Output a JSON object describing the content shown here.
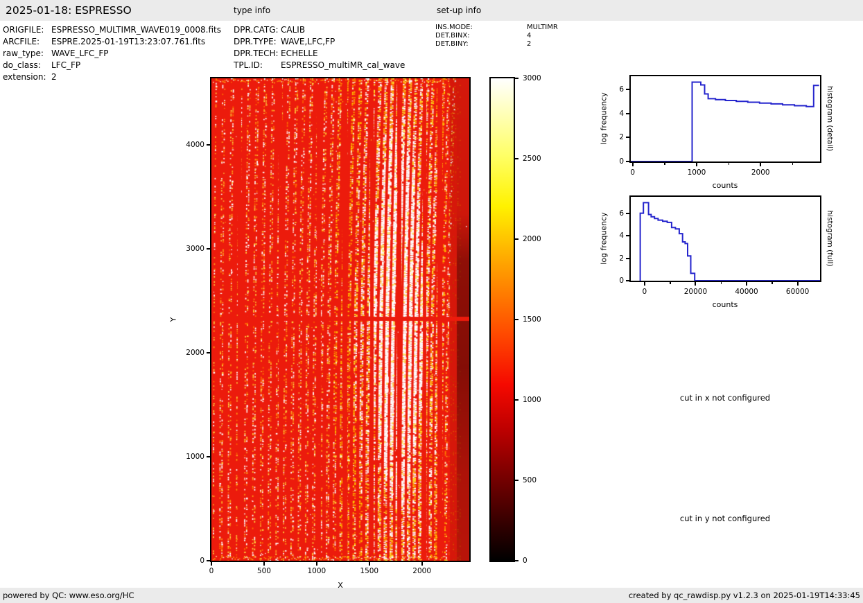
{
  "header": {
    "title": "2025-01-18: ESPRESSO",
    "type_info": "type info",
    "setup_info": "set-up info"
  },
  "file_info": {
    "rows": [
      {
        "label": "ORIGFILE:",
        "value": "ESPRESSO_MULTIMR_WAVE019_0008.fits"
      },
      {
        "label": "ARCFILE:",
        "value": "ESPRE.2025-01-19T13:23:07.761.fits"
      },
      {
        "label": "raw_type:",
        "value": "WAVE_LFC_FP"
      },
      {
        "label": "do_class:",
        "value": "LFC_FP"
      },
      {
        "label": "extension:",
        "value": "2"
      }
    ]
  },
  "type_info": {
    "rows": [
      {
        "label": "DPR.CATG:",
        "value": "CALIB"
      },
      {
        "label": "DPR.TYPE:",
        "value": "WAVE,LFC,FP"
      },
      {
        "label": "DPR.TECH:",
        "value": "ECHELLE"
      },
      {
        "label": "TPL.ID:",
        "value": "ESPRESSO_multiMR_cal_wave"
      }
    ]
  },
  "setup_info": {
    "rows": [
      {
        "label": "INS.MODE:",
        "value": "MULTIMR"
      },
      {
        "label": "DET.BINX:",
        "value": "4"
      },
      {
        "label": "DET.BINY:",
        "value": "2"
      }
    ]
  },
  "colors": {
    "background_red": "#ec1b0c",
    "histogram_blue": "#2525cd",
    "panel_gray": "#ebebeb"
  },
  "cuts": {
    "x": "cut in x not configured",
    "y": "cut in y not configured"
  },
  "footer": {
    "left": "powered by QC: www.eso.org/HC",
    "right": "created by qc_rawdisp.py v1.2.3 on 2025-01-19T14:33:45"
  },
  "chart_data": [
    {
      "id": "raw_frame",
      "type": "heatmap",
      "xlabel": "X",
      "ylabel": "Y",
      "xlim": [
        0,
        2450
      ],
      "ylim": [
        0,
        4640
      ],
      "xticks": [
        0,
        500,
        1000,
        1500,
        2000
      ],
      "yticks": [
        0,
        1000,
        2000,
        3000,
        4000
      ],
      "colormap": "hot",
      "value_range": [
        0,
        3000
      ],
      "colorbar_ticks": [
        0,
        500,
        1000,
        1500,
        2000,
        2500,
        3000
      ],
      "description": "Raw ESPRESSO LFC+FP echelle calibration frame: dense comb of slanted dotted emission columns (yellow/white on red), saturated white band near x=1400-2150, uniform red horizontal inter-chip gap at y=2330, low-signal dark-red margin for x>2300"
    },
    {
      "id": "histogram_detail",
      "type": "line",
      "right_label": "histogram (detail)",
      "xlabel": "counts",
      "ylabel": "log frequency",
      "line_color": "#2525cd",
      "xlim": [
        -30,
        2930
      ],
      "ylim": [
        0,
        7.09
      ],
      "xticks": [
        0,
        1000,
        2000
      ],
      "xminorticks": [
        500,
        1500,
        2500
      ],
      "yticks": [
        0,
        2,
        4,
        6
      ],
      "steps": [
        [
          -30,
          930,
          0
        ],
        [
          930,
          1065,
          6.6
        ],
        [
          1065,
          1125,
          6.37
        ],
        [
          1125,
          1180,
          5.62
        ],
        [
          1180,
          1295,
          5.22
        ],
        [
          1295,
          1450,
          5.14
        ],
        [
          1450,
          1620,
          5.07
        ],
        [
          1620,
          1800,
          5.0
        ],
        [
          1800,
          1985,
          4.93
        ],
        [
          1985,
          2165,
          4.86
        ],
        [
          2165,
          2345,
          4.79
        ],
        [
          2345,
          2530,
          4.71
        ],
        [
          2530,
          2715,
          4.64
        ],
        [
          2715,
          2830,
          4.57
        ],
        [
          2830,
          2915,
          6.33
        ]
      ]
    },
    {
      "id": "histogram_full",
      "type": "line",
      "right_label": "histogram (full)",
      "xlabel": "counts",
      "ylabel": "log frequency",
      "line_color": "#2525cd",
      "xlim": [
        -5400,
        68800
      ],
      "ylim": [
        0,
        7.45
      ],
      "xticks": [
        0,
        20000,
        40000,
        60000
      ],
      "xminorticks": [
        10000,
        30000,
        50000
      ],
      "yticks": [
        0,
        2,
        4,
        6
      ],
      "steps": [
        [
          -1700,
          -450,
          6.0
        ],
        [
          -450,
          1550,
          6.93
        ],
        [
          1550,
          2600,
          5.88
        ],
        [
          2600,
          3900,
          5.68
        ],
        [
          3900,
          5300,
          5.53
        ],
        [
          5300,
          7100,
          5.38
        ],
        [
          7100,
          8900,
          5.28
        ],
        [
          8900,
          10600,
          5.18
        ],
        [
          10600,
          12100,
          4.72
        ],
        [
          12100,
          13600,
          4.6
        ],
        [
          13600,
          14900,
          4.18
        ],
        [
          14900,
          15900,
          3.45
        ],
        [
          15900,
          16900,
          3.3
        ],
        [
          16900,
          18100,
          2.2
        ],
        [
          18100,
          19650,
          0.65
        ],
        [
          19650,
          68800,
          0
        ]
      ]
    }
  ]
}
